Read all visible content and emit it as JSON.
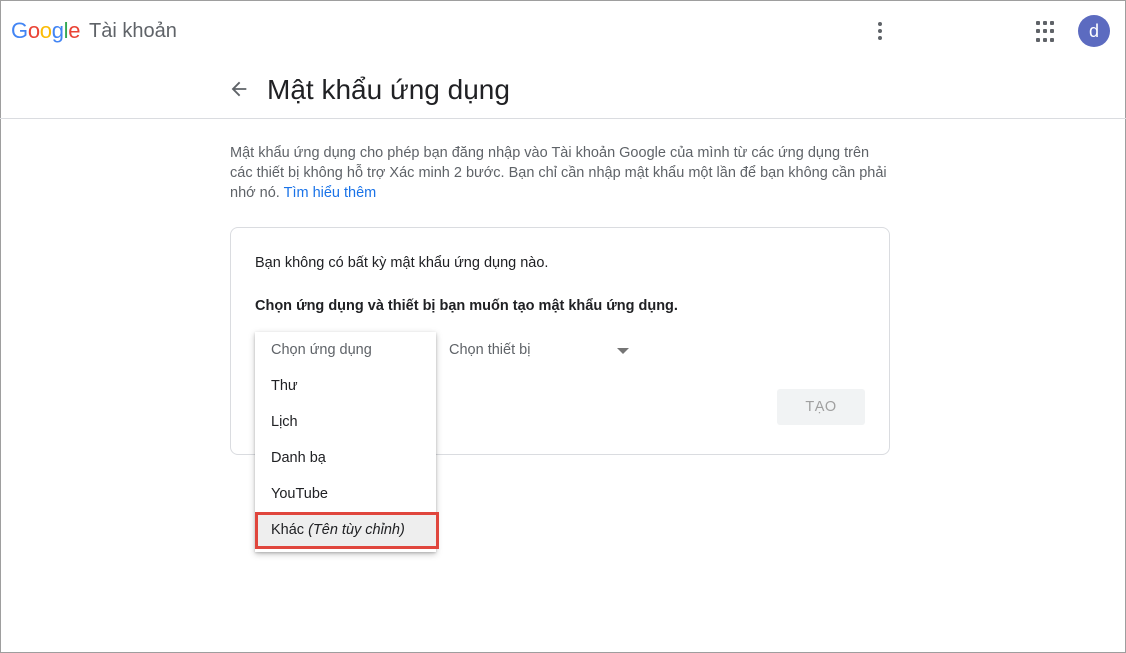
{
  "header": {
    "logo": [
      "G",
      "o",
      "o",
      "g",
      "l",
      "e"
    ],
    "product": "Tài khoản",
    "avatar_letter": "d"
  },
  "page": {
    "title": "Mật khẩu ứng dụng"
  },
  "description": {
    "text": "Mật khẩu ứng dụng cho phép bạn đăng nhập vào Tài khoản Google của mình từ các ứng dụng trên các thiết bị không hỗ trợ Xác minh 2 bước. Bạn chỉ cần nhập mật khẩu một lần để bạn không cần phải nhớ nó. ",
    "link": "Tìm hiểu thêm"
  },
  "card": {
    "no_passwords": "Bạn không có bất kỳ mật khẩu ứng dụng nào.",
    "choose_label": "Chọn ứng dụng và thiết bị bạn muốn tạo mật khẩu ứng dụng.",
    "device_placeholder": "Chọn thiết bị",
    "create_button": "TẠO"
  },
  "app_menu": {
    "placeholder": "Chọn ứng dụng",
    "options": [
      "Thư",
      "Lịch",
      "Danh bạ",
      "YouTube"
    ],
    "other_label": "Khác",
    "other_hint": "(Tên tùy chỉnh)"
  },
  "icons": {
    "back": "arrow-back-icon",
    "more": "more-vert-icon",
    "apps": "apps-grid-icon"
  },
  "colors": {
    "link": "#1a73e8",
    "avatar_bg": "#5c6bc0",
    "highlight_border": "#e0463d"
  }
}
